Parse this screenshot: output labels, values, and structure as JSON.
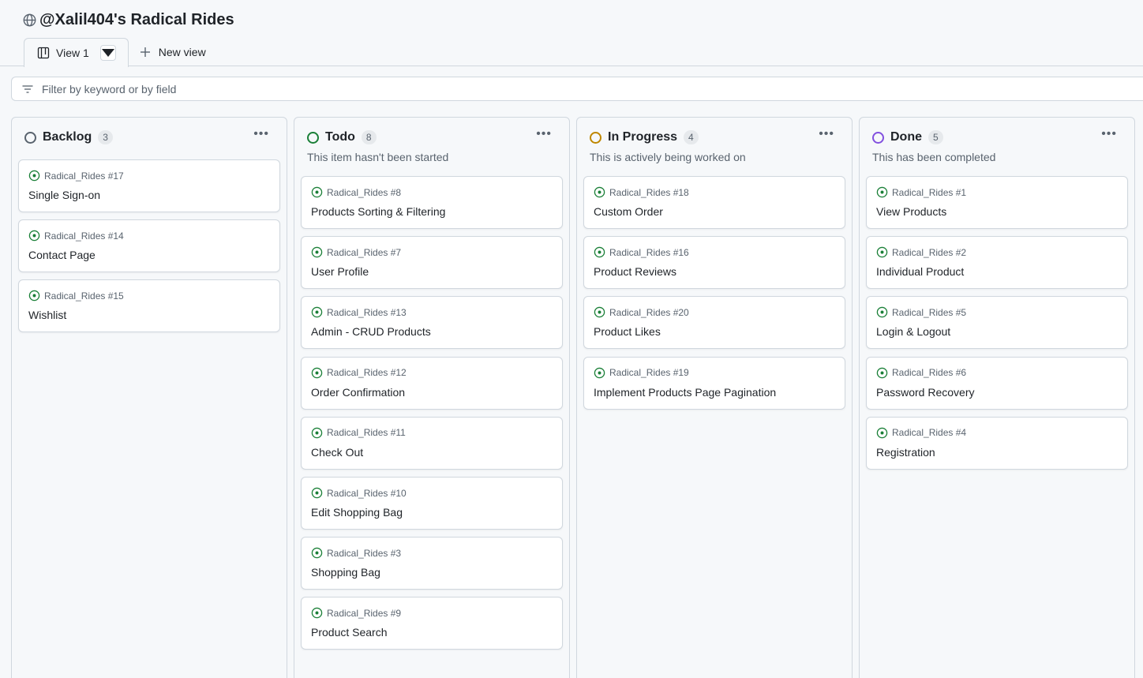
{
  "project": {
    "title": "@Xalil404's Radical Rides"
  },
  "tabs": {
    "active_label": "View 1",
    "new_view_label": "New view"
  },
  "filter": {
    "placeholder": "Filter by keyword or by field"
  },
  "columns": [
    {
      "name": "Backlog",
      "count": "3",
      "description": "",
      "color": "#59636e",
      "cards": [
        {
          "ref": "Radical_Rides #17",
          "title": "Single Sign-on"
        },
        {
          "ref": "Radical_Rides #14",
          "title": "Contact Page"
        },
        {
          "ref": "Radical_Rides #15",
          "title": "Wishlist"
        }
      ]
    },
    {
      "name": "Todo",
      "count": "8",
      "description": "This item hasn't been started",
      "color": "#1a7f37",
      "cards": [
        {
          "ref": "Radical_Rides #8",
          "title": "Products Sorting & Filtering"
        },
        {
          "ref": "Radical_Rides #7",
          "title": "User Profile"
        },
        {
          "ref": "Radical_Rides #13",
          "title": "Admin - CRUD Products"
        },
        {
          "ref": "Radical_Rides #12",
          "title": "Order Confirmation"
        },
        {
          "ref": "Radical_Rides #11",
          "title": "Check Out"
        },
        {
          "ref": "Radical_Rides #10",
          "title": "Edit Shopping Bag"
        },
        {
          "ref": "Radical_Rides #3",
          "title": "Shopping Bag"
        },
        {
          "ref": "Radical_Rides #9",
          "title": "Product Search"
        }
      ]
    },
    {
      "name": "In Progress",
      "count": "4",
      "description": "This is actively being worked on",
      "color": "#bf8700",
      "cards": [
        {
          "ref": "Radical_Rides #18",
          "title": "Custom Order"
        },
        {
          "ref": "Radical_Rides #16",
          "title": "Product Reviews"
        },
        {
          "ref": "Radical_Rides #20",
          "title": "Product Likes"
        },
        {
          "ref": "Radical_Rides #19",
          "title": "Implement Products Page Pagination"
        }
      ]
    },
    {
      "name": "Done",
      "count": "5",
      "description": "This has been completed",
      "color": "#8250df",
      "cards": [
        {
          "ref": "Radical_Rides #1",
          "title": "View Products"
        },
        {
          "ref": "Radical_Rides #2",
          "title": "Individual Product"
        },
        {
          "ref": "Radical_Rides #5",
          "title": "Login & Logout"
        },
        {
          "ref": "Radical_Rides #6",
          "title": "Password Recovery"
        },
        {
          "ref": "Radical_Rides #4",
          "title": "Registration"
        }
      ]
    }
  ],
  "colors": {
    "issue_open": "#1a7f37"
  }
}
